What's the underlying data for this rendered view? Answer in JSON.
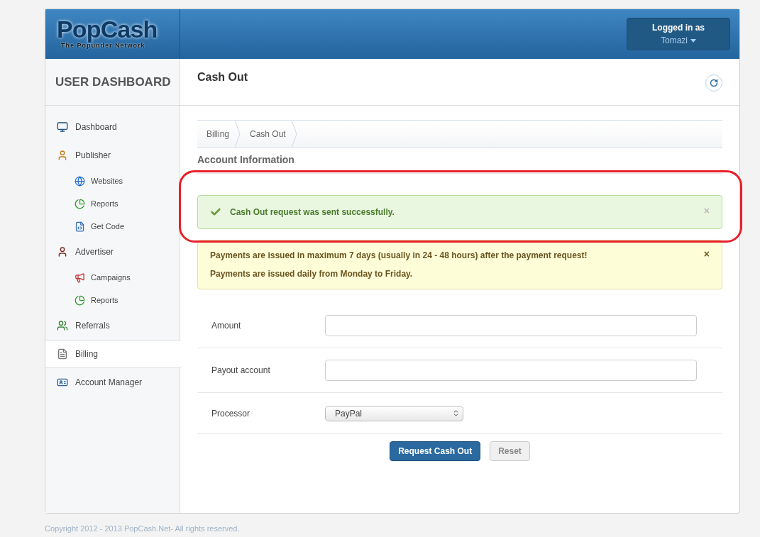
{
  "logo": {
    "name": "PopCash",
    "tagline": "The Popunder Network"
  },
  "user_menu": {
    "label": "Logged in as",
    "user": "Tomazi"
  },
  "sidebar": {
    "title": "USER DASHBOARD",
    "items": [
      {
        "label": "Dashboard",
        "selected": false
      },
      {
        "label": "Publisher",
        "selected": false,
        "children": [
          {
            "label": "Websites",
            "selected": false
          },
          {
            "label": "Reports",
            "selected": false
          },
          {
            "label": "Get Code",
            "selected": false
          }
        ]
      },
      {
        "label": "Advertiser",
        "selected": false,
        "children": [
          {
            "label": "Campaigns",
            "selected": false
          },
          {
            "label": "Reports",
            "selected": false
          }
        ]
      },
      {
        "label": "Referrals",
        "selected": false
      },
      {
        "label": "Billing",
        "selected": true
      },
      {
        "label": "Account Manager",
        "selected": false
      }
    ]
  },
  "page_title": "Cash Out",
  "breadcrumb": [
    "Billing",
    "Cash Out"
  ],
  "section_title": "Account Information",
  "alerts": [
    {
      "kind": "success",
      "lines": [
        "Cash Out request was sent successfully."
      ],
      "close": "×"
    },
    {
      "kind": "warning",
      "lines": [
        "Payments are issued in maximum 7 days (usually in 24 - 48 hours) after the payment request!",
        "Payments are issued daily from Monday to Friday."
      ],
      "close": "×"
    }
  ],
  "form": [
    {
      "kind": "input",
      "label": "Amount"
    },
    {
      "kind": "input",
      "label": "Payout account"
    },
    {
      "kind": "select",
      "label": "Processor",
      "value": "PayPal"
    }
  ],
  "buttons": [
    {
      "kind": "primary",
      "label": "Request Cash Out"
    },
    {
      "kind": "default",
      "label": "Reset"
    }
  ],
  "footer": "Copyright 2012 - 2013 PopCash.Net- All rights reserved."
}
